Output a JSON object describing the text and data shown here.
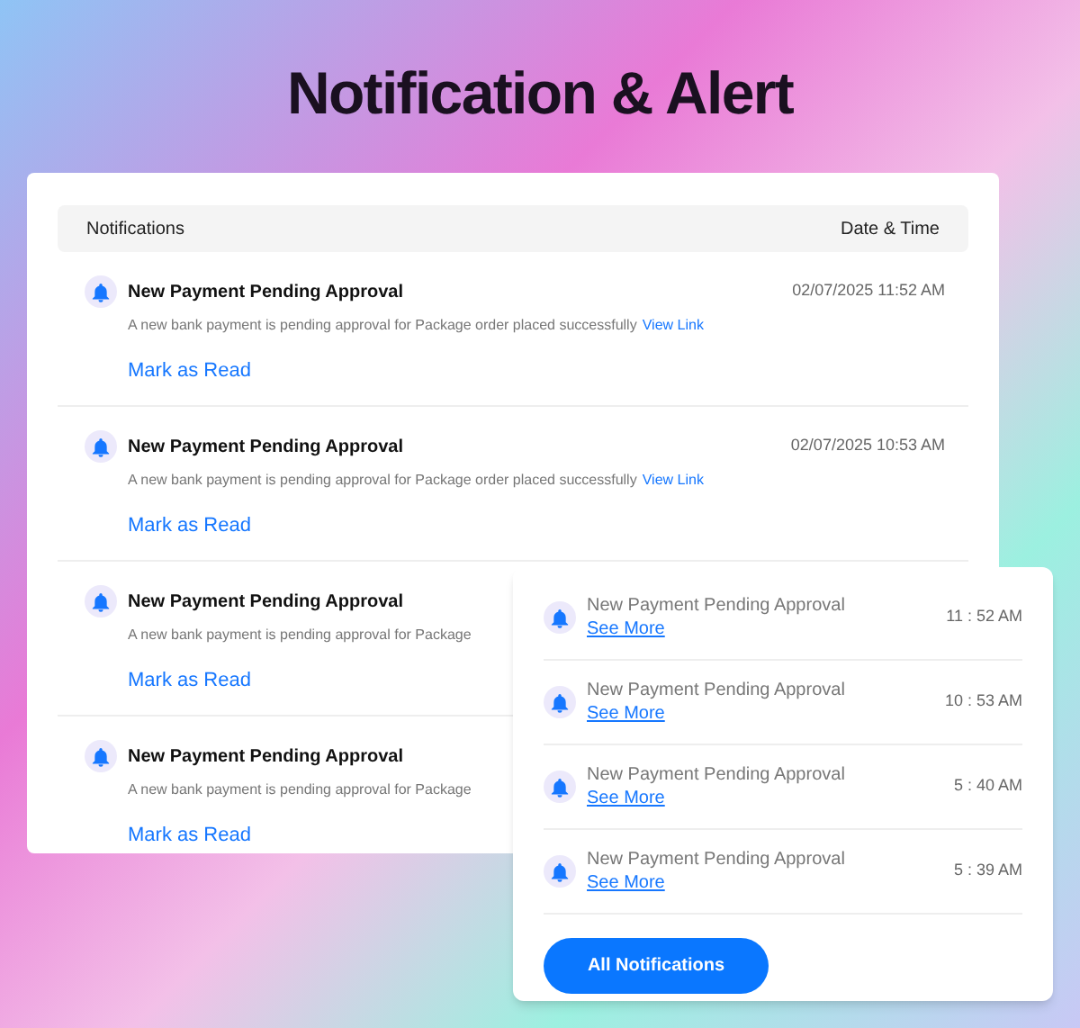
{
  "heading": "Notification & Alert",
  "table": {
    "columns": [
      "Notifications",
      "Date & Time"
    ],
    "rows": [
      {
        "title": "New Payment Pending Approval",
        "description": "A new bank payment is pending approval for Package order placed successfully",
        "link": "View Link",
        "date": "02/07/2025 11:52 AM",
        "action": "Mark as Read"
      },
      {
        "title": "New Payment Pending Approval",
        "description": "A new bank payment is pending approval for Package order placed successfully",
        "link": "View Link",
        "date": "02/07/2025 10:53 AM",
        "action": "Mark as Read"
      },
      {
        "title": "New Payment Pending Approval",
        "description": "A new bank payment is pending approval for Package",
        "action": "Mark as Read"
      },
      {
        "title": "New Payment Pending Approval",
        "description": "A new bank payment is pending approval for Package",
        "action": "Mark as Read"
      }
    ]
  },
  "popup": {
    "items": [
      {
        "text": "New Payment Pending Approval",
        "link": "See More",
        "time": "11 : 52 AM"
      },
      {
        "text": "New Payment Pending Approval",
        "link": "See More",
        "time": "10 : 53 AM"
      },
      {
        "text": "New Payment Pending Approval",
        "link": "See More",
        "time": "5 : 40 AM"
      },
      {
        "text": "New Payment Pending Approval",
        "link": "See More",
        "time": "5 : 39 AM"
      }
    ],
    "button": "All Notifications"
  }
}
